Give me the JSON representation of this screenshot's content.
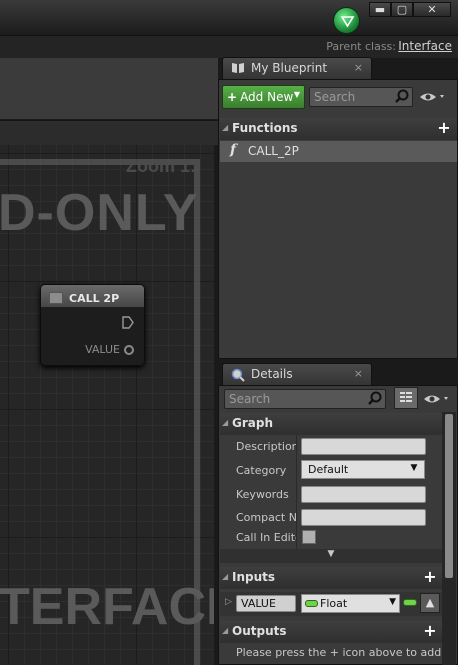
{
  "window": {
    "minimize": "▬",
    "maximize": "▢",
    "close": "✕"
  },
  "parent": {
    "label": "Parent class:",
    "value": "Interface"
  },
  "graph": {
    "zoom": "Zoom 1:",
    "watermark_top": "D-ONLY",
    "watermark_bottom": "TERFACE",
    "node": {
      "title": "CALL 2P",
      "output_pin": "VALUE"
    }
  },
  "my_blueprint": {
    "tab_label": "My Blueprint",
    "tab_close": "×",
    "add_new": "Add New",
    "search_placeholder": "Search",
    "functions_header": "Functions",
    "functions": [
      {
        "name": "CALL_2P"
      }
    ]
  },
  "details": {
    "tab_label": "Details",
    "tab_close": "×",
    "search_placeholder": "Search",
    "graph_header": "Graph",
    "properties": {
      "description": "Description",
      "category": "Category",
      "category_value": "Default",
      "keywords": "Keywords",
      "compact_node": "Compact No",
      "call_in_editor": "Call In Edito"
    },
    "inputs_header": "Inputs",
    "input": {
      "name": "VALUE",
      "type": "Float"
    },
    "outputs_header": "Outputs",
    "outputs_hint": "Please press the + icon above to add para"
  },
  "colors": {
    "accent_green": "#4a9a3c",
    "float_pin": "#6ed34a"
  },
  "icons": [
    "unreal-logo-icon",
    "book-icon",
    "magnifier-icon",
    "eye-icon",
    "plus-icon",
    "function-icon",
    "grid-view-icon",
    "exec-pin-icon",
    "value-pin-icon",
    "array-arrow-icon"
  ]
}
